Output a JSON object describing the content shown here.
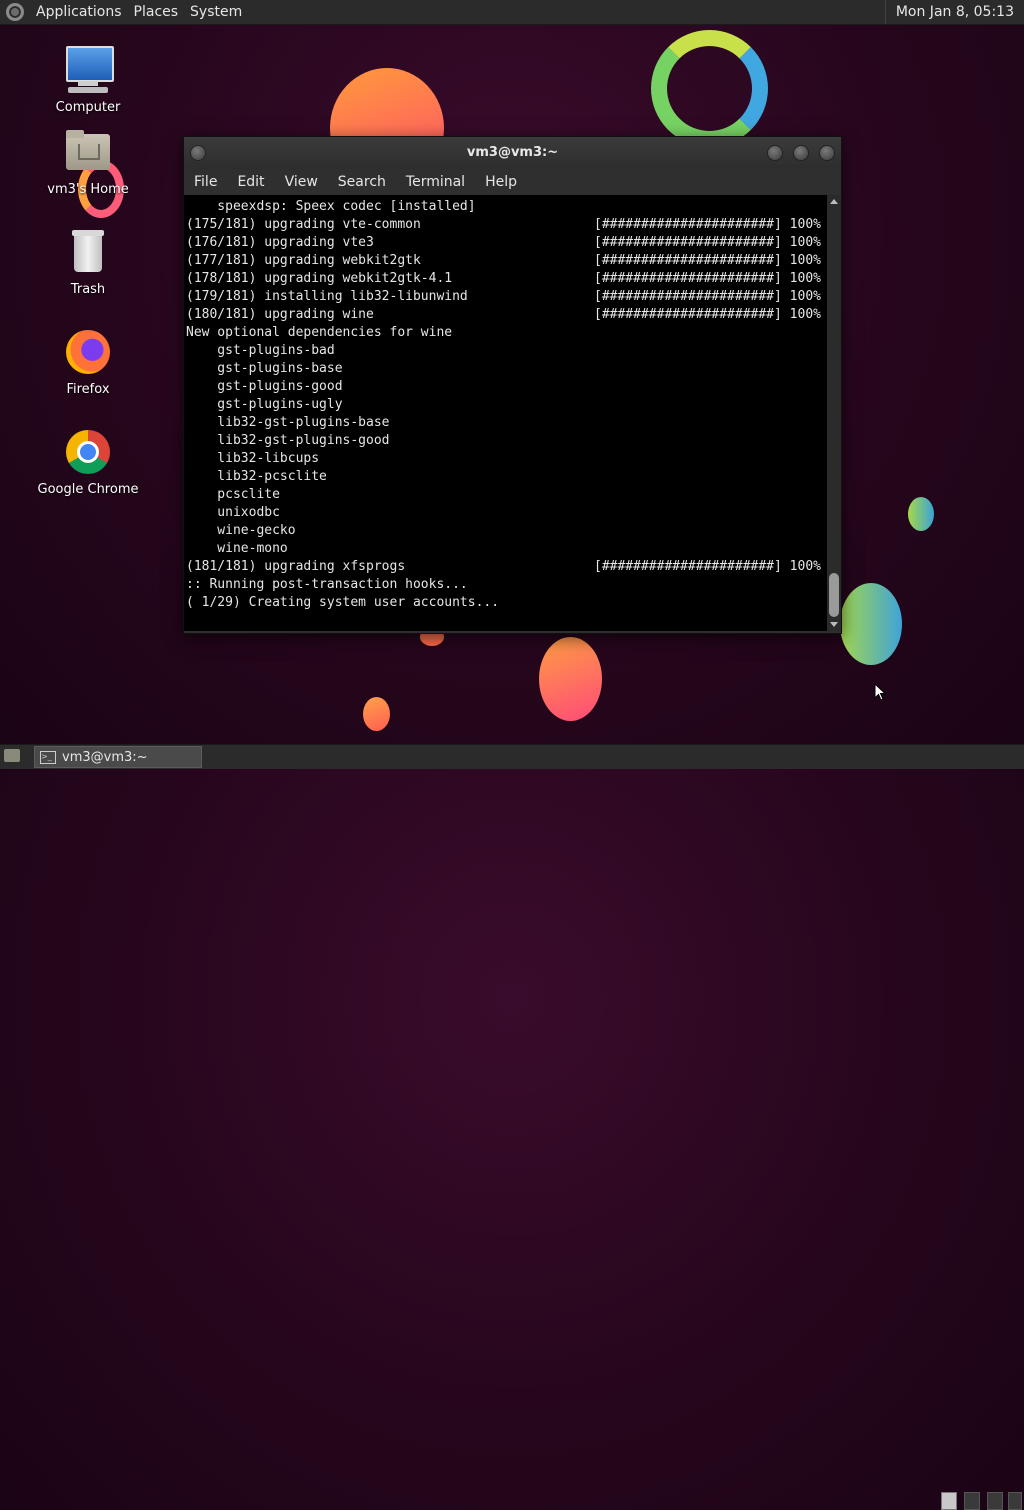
{
  "top_panel": {
    "menus": [
      "Applications",
      "Places",
      "System"
    ],
    "clock": "Mon Jan  8, 05:13"
  },
  "desktop_icons": [
    {
      "label": "Computer",
      "icon": "computer-icon"
    },
    {
      "label": "vm3's Home",
      "icon": "home-folder-icon"
    },
    {
      "label": "Trash",
      "icon": "trash-icon"
    },
    {
      "label": "Firefox",
      "icon": "firefox-icon"
    },
    {
      "label": "Google Chrome",
      "icon": "chrome-icon"
    }
  ],
  "terminal": {
    "title": "vm3@vm3:~",
    "menus": [
      "File",
      "Edit",
      "View",
      "Search",
      "Terminal",
      "Help"
    ],
    "lines": [
      {
        "text": "    speexdsp: Speex codec [installed]",
        "progress": ""
      },
      {
        "text": "(175/181) upgrading vte-common",
        "progress": "[######################] 100%"
      },
      {
        "text": "(176/181) upgrading vte3",
        "progress": "[######################] 100%"
      },
      {
        "text": "(177/181) upgrading webkit2gtk",
        "progress": "[######################] 100%"
      },
      {
        "text": "(178/181) upgrading webkit2gtk-4.1",
        "progress": "[######################] 100%"
      },
      {
        "text": "(179/181) installing lib32-libunwind",
        "progress": "[######################] 100%"
      },
      {
        "text": "(180/181) upgrading wine",
        "progress": "[######################] 100%"
      },
      {
        "text": "New optional dependencies for wine",
        "progress": ""
      },
      {
        "text": "    gst-plugins-bad",
        "progress": ""
      },
      {
        "text": "    gst-plugins-base",
        "progress": ""
      },
      {
        "text": "    gst-plugins-good",
        "progress": ""
      },
      {
        "text": "    gst-plugins-ugly",
        "progress": ""
      },
      {
        "text": "    lib32-gst-plugins-base",
        "progress": ""
      },
      {
        "text": "    lib32-gst-plugins-good",
        "progress": ""
      },
      {
        "text": "    lib32-libcups",
        "progress": ""
      },
      {
        "text": "    lib32-pcsclite",
        "progress": ""
      },
      {
        "text": "    pcsclite",
        "progress": ""
      },
      {
        "text": "    unixodbc",
        "progress": ""
      },
      {
        "text": "    wine-gecko",
        "progress": ""
      },
      {
        "text": "    wine-mono",
        "progress": ""
      },
      {
        "text": "(181/181) upgrading xfsprogs",
        "progress": "[######################] 100%"
      },
      {
        "text": ":: Running post-transaction hooks...",
        "progress": ""
      },
      {
        "text": "( 1/29) Creating system user accounts...",
        "progress": ""
      }
    ]
  },
  "taskbar": {
    "tasks": [
      {
        "label": "vm3@vm3:~",
        "icon": "terminal-icon"
      }
    ]
  }
}
